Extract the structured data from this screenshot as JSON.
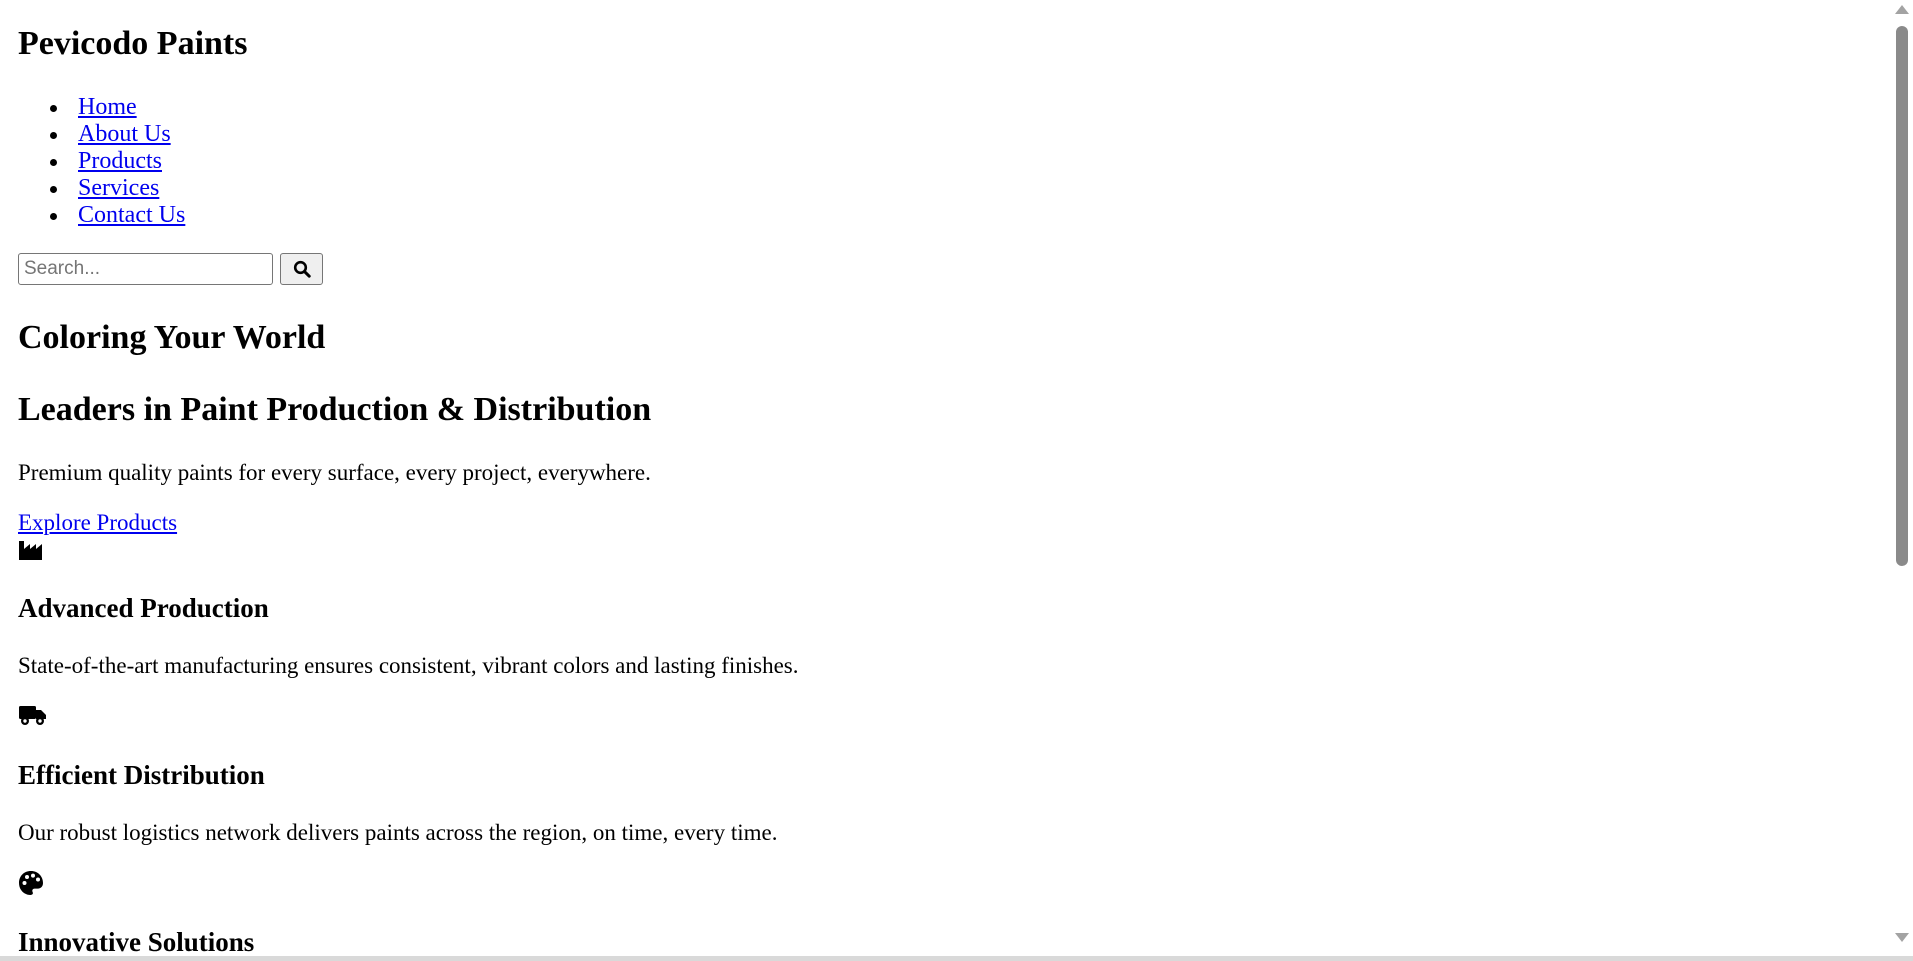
{
  "header": {
    "site_title": "Pevicodo Paints"
  },
  "nav": {
    "items": [
      {
        "label": "Home"
      },
      {
        "label": "About Us"
      },
      {
        "label": "Products"
      },
      {
        "label": "Services"
      },
      {
        "label": "Contact Us"
      }
    ]
  },
  "search": {
    "placeholder": "Search...",
    "value": "",
    "button_icon": "search-icon"
  },
  "hero": {
    "title": "Coloring Your World",
    "subtitle": "Leaders in Paint Production & Distribution",
    "text": "Premium quality paints for every surface, every project, everywhere.",
    "cta_label": "Explore Products"
  },
  "features": [
    {
      "icon": "industry-icon",
      "title": "Advanced Production",
      "text": "State-of-the-art manufacturing ensures consistent, vibrant colors and lasting finishes."
    },
    {
      "icon": "truck-icon",
      "title": "Efficient Distribution",
      "text": "Our robust logistics network delivers paints across the region, on time, every time."
    },
    {
      "icon": "palette-icon",
      "title": "Innovative Solutions"
    }
  ],
  "colors": {
    "link": "#0000ee",
    "text": "#000000",
    "background": "#ffffff"
  }
}
